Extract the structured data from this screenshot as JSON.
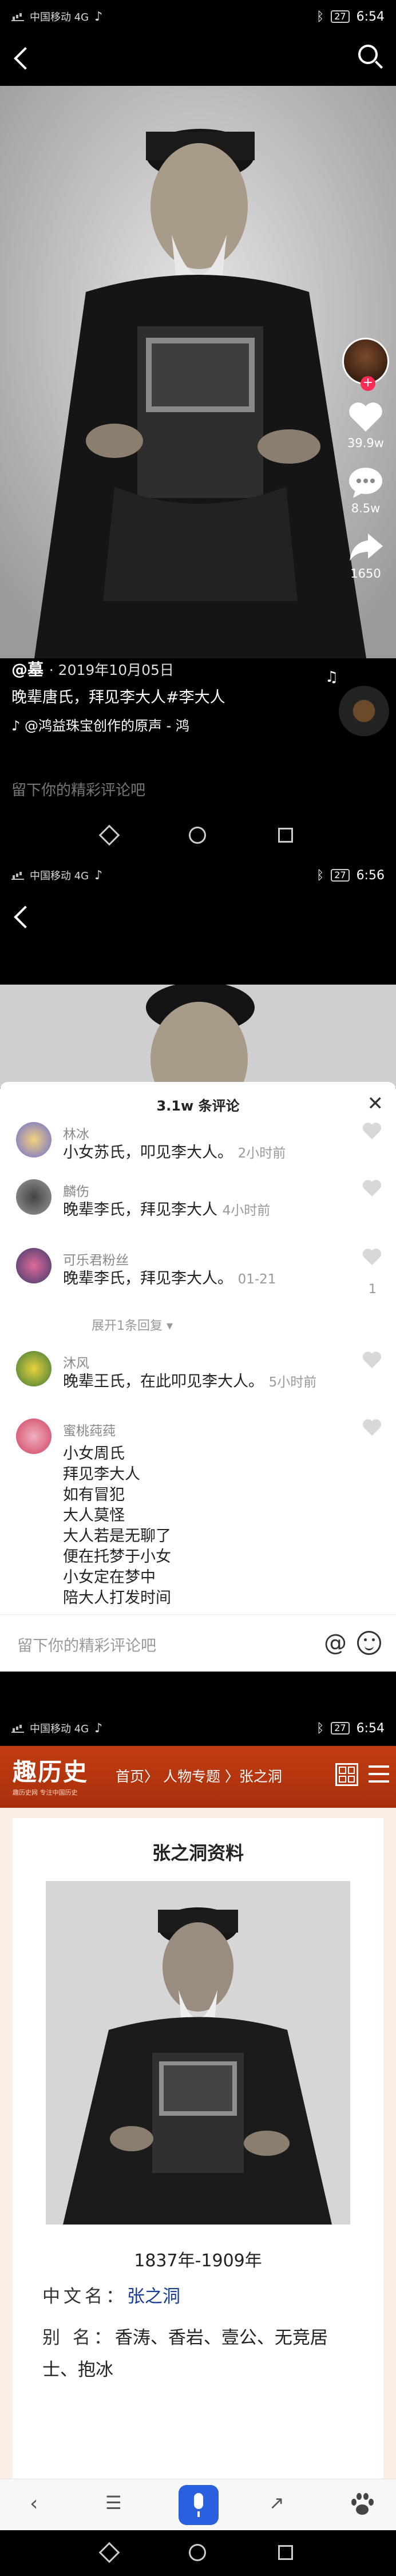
{
  "screen1": {
    "status": {
      "left": "中国移动 4G",
      "battery": "27",
      "time": "6:54"
    },
    "actions": {
      "likes": "39.9w",
      "comments": "8.5w",
      "shares": "1650"
    },
    "author": "@墓",
    "date": "· 2019年10月05日",
    "caption": "晚辈唐氏，拜见李大人#李大人",
    "music": "@鸿益珠宝创作的原声 - 鸿",
    "comment_placeholder": "留下你的精彩评论吧"
  },
  "screen2": {
    "status": {
      "left": "中国移动 4G",
      "battery": "27",
      "time": "6:56"
    },
    "sheet_title": "3.1w 条评论",
    "comments": [
      {
        "name": "林冰",
        "text": "小女苏氏，叩见李大人。",
        "time": "2小时前",
        "likes": ""
      },
      {
        "name": "麟伤",
        "text": "晚辈李氏，拜见李大人",
        "time": "4小时前",
        "likes": ""
      },
      {
        "name": "可乐君粉丝",
        "text": "晚辈李氏，拜见李大人。",
        "time": "01-21",
        "likes": "1"
      },
      {
        "name": "沐风",
        "text": "晚辈王氏，在此叩见李大人。",
        "time": "5小时前",
        "likes": ""
      },
      {
        "name": "蜜桃莼莼",
        "text": "小女周氏\n拜见李大人\n如有冒犯\n大人莫怪\n大人若是无聊了\n便在托梦于小女\n小女定在梦中\n陪大人打发时间",
        "time": "",
        "likes": ""
      }
    ],
    "expand_text": "展开1条回复 ▾",
    "input_placeholder": "留下你的精彩评论吧",
    "at_symbol": "@"
  },
  "screen3": {
    "status": {
      "left": "中国移动 4G",
      "battery": "27",
      "time": "6:54"
    },
    "logo": "趣历史",
    "logo_sub": "趣历史网 专注中国历史",
    "breadcrumb": "首页〉 人物专题 〉张之洞",
    "article_title": "张之洞资料",
    "years": "1837年-1909年",
    "fields": [
      {
        "key": "中文名：",
        "value": "张之洞"
      },
      {
        "key": "别 名：",
        "value": "香涛、香岩、壹公、无竞居士、抱冰"
      }
    ]
  },
  "colors": {
    "accent_red": "#fe2c55",
    "site_red": "#b3340e",
    "link_blue": "#1a3d9c"
  }
}
